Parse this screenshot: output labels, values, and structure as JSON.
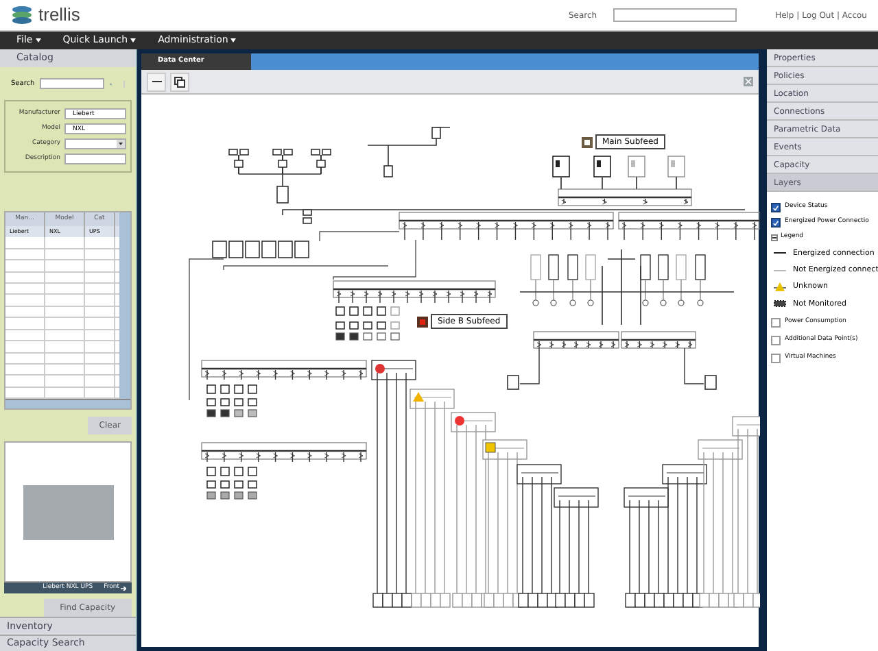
{
  "header": {
    "logo": "trellis",
    "search_label": "Search",
    "links": "Help | Log Out | Accou"
  },
  "menu": [
    {
      "label": "File"
    },
    {
      "label": "Quick Launch"
    },
    {
      "label": "Administration"
    }
  ],
  "catalog": {
    "title": "Catalog",
    "search_label": "Search",
    "fields": [
      {
        "label": "Manufacturer",
        "value": "Liebert",
        "kind": "text"
      },
      {
        "label": "Model",
        "value": "NXL",
        "kind": "text"
      },
      {
        "label": "Category",
        "kind": "select"
      },
      {
        "label": "Description",
        "kind": "text"
      }
    ],
    "table": {
      "columns": [
        "Man...",
        "Model",
        "Cat"
      ],
      "rows": [
        [
          "Liebert",
          "NXL",
          "UPS"
        ]
      ]
    },
    "clear_button": "Clear",
    "image_caption": "Liebert NXL UPS",
    "image_view": "Front",
    "find_button": "Find Capacity",
    "sections": [
      "Inventory",
      "Capacity Search"
    ]
  },
  "tab": {
    "label": "Data Center"
  },
  "diagram": {
    "labels": [
      {
        "text": "Main Subfeed",
        "kind": "main"
      },
      {
        "text": "Side B Subfeed",
        "kind": "side"
      }
    ]
  },
  "properties": {
    "sections": [
      {
        "label": "Properties",
        "expanded": false
      },
      {
        "label": "Policies",
        "expanded": false
      },
      {
        "label": "Location",
        "expanded": false
      },
      {
        "label": "Connections",
        "expanded": false
      },
      {
        "label": "Parametric Data",
        "expanded": false
      },
      {
        "label": "Events",
        "expanded": false
      },
      {
        "label": "Capacity",
        "expanded": false
      },
      {
        "label": "Layers",
        "expanded": true
      }
    ],
    "layers": [
      {
        "label": "Device Status",
        "checked": true
      },
      {
        "label": "Energized Power Connectio",
        "checked": true
      }
    ],
    "legend": {
      "title": "Legend",
      "expanded": true,
      "items": [
        {
          "kind": "energized",
          "label": "Energized connection"
        },
        {
          "kind": "not_energized",
          "label": "Not Energized connect"
        },
        {
          "kind": "unknown",
          "label": "Unknown"
        },
        {
          "kind": "not_monitored",
          "label": "Not Monitored"
        }
      ]
    },
    "more_layers": [
      {
        "label": "Power Consumption",
        "checked": false
      },
      {
        "label": "Additional Data Point(s)",
        "checked": false
      },
      {
        "label": "Virtual Machines",
        "checked": false
      }
    ]
  }
}
